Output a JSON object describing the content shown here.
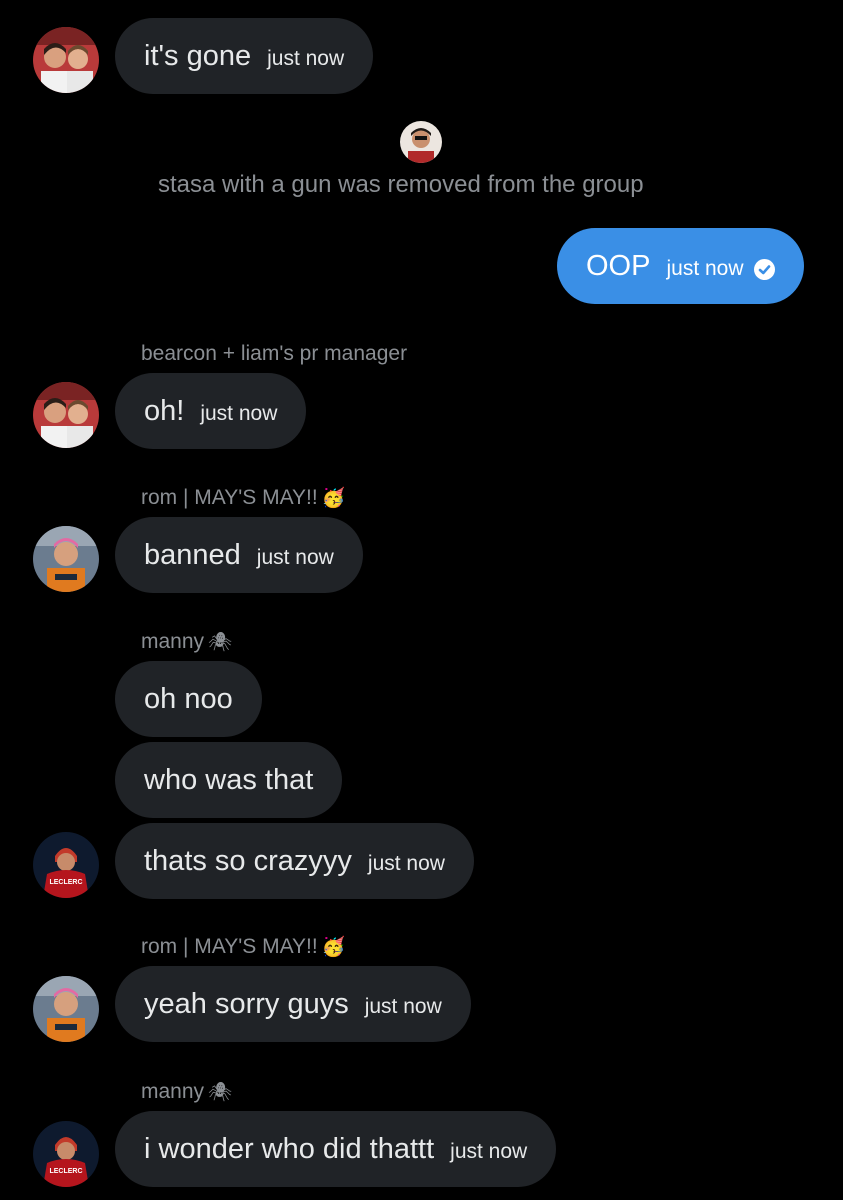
{
  "messages": [
    {
      "text": "it's gone",
      "time": "just now"
    },
    {
      "text": "OOP",
      "time": "just now"
    },
    {
      "text": "oh!",
      "time": "just now"
    },
    {
      "text": "banned",
      "time": "just now"
    },
    {
      "text": "oh noo"
    },
    {
      "text": "who was that"
    },
    {
      "text": "thats so crazyyy",
      "time": "just now"
    },
    {
      "text": "yeah sorry guys",
      "time": "just now"
    },
    {
      "text": "i wonder who did thattt",
      "time": "just now"
    }
  ],
  "system_event": {
    "text": "stasa with a gun was removed from the group"
  },
  "senders": {
    "bearcon": "bearcon + liam's pr manager",
    "rom": "rom | MAY'S MAY!!",
    "rom_emoji": "🥳",
    "manny": "manny",
    "manny_emoji": "🕷"
  },
  "avatar_text": {
    "leclerc": "LECLERC"
  },
  "colors": {
    "background": "#000000",
    "incoming_bubble": "#202327",
    "outgoing_bubble": "#3a8fe6",
    "muted_text": "#8b8f94"
  }
}
